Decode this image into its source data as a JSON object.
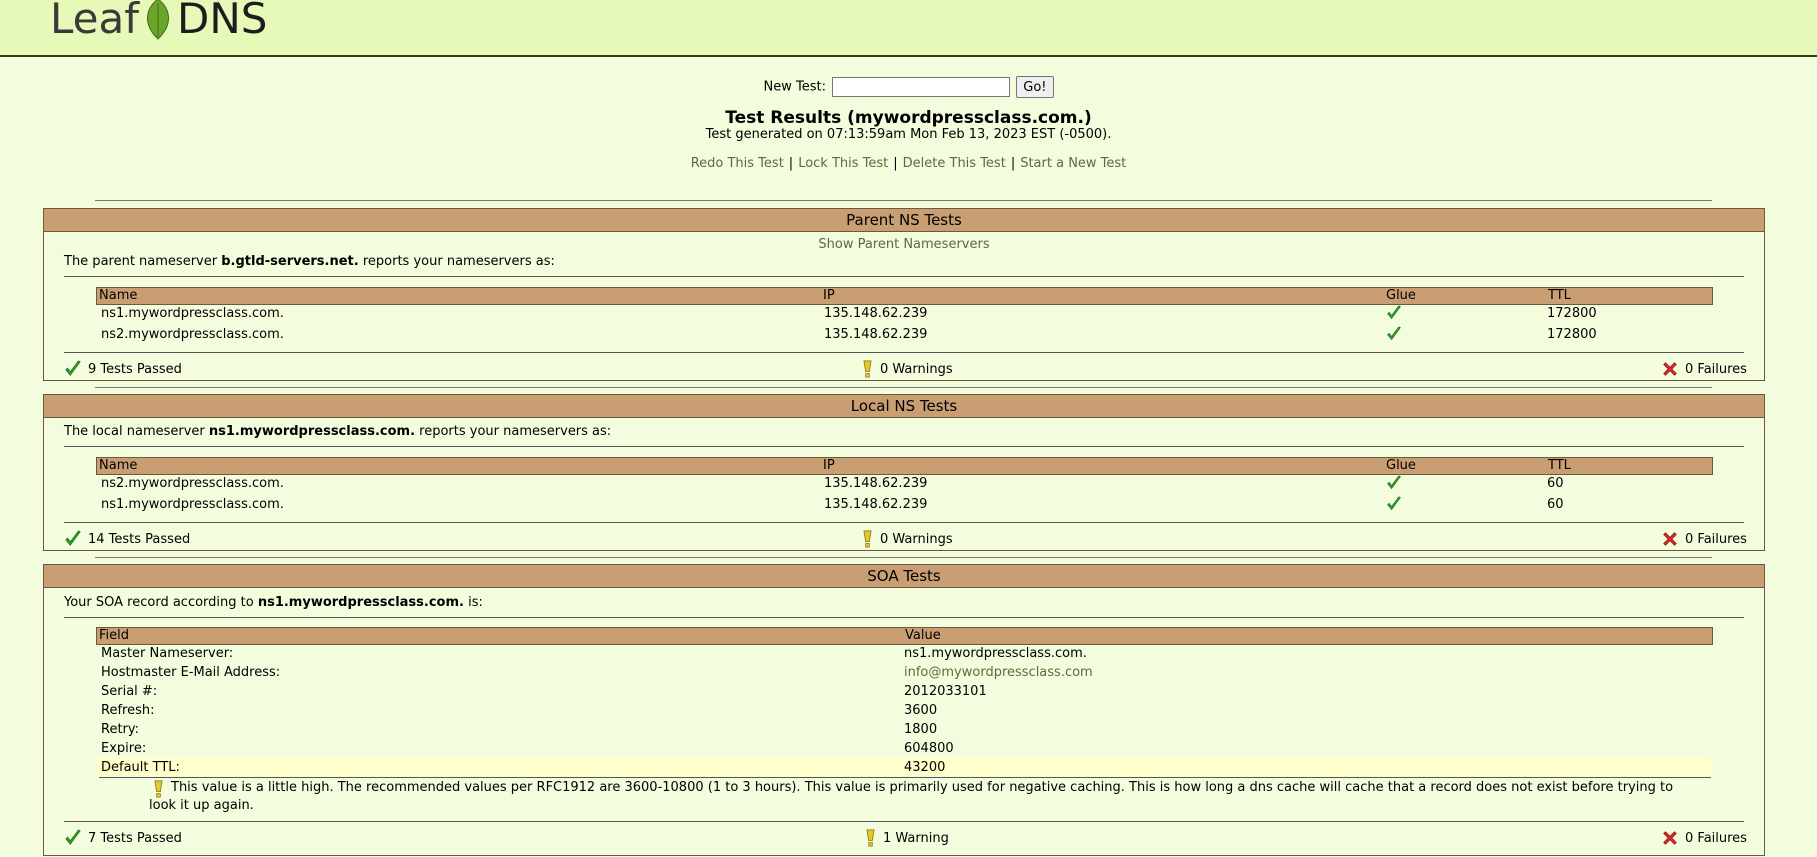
{
  "brand": {
    "left": "Leaf",
    "right": "DNS",
    "accent": "#6aa52a"
  },
  "new_test": {
    "label": "New Test:",
    "value": "",
    "button": "Go!"
  },
  "results_title": "Test Results (mywordpressclass.com.)",
  "generated": "Test generated on 07:13:59am Mon Feb 13, 2023 EST (-0500).",
  "actions": [
    "Redo This Test",
    "Lock This Test",
    "Delete This Test",
    "Start a New Test"
  ],
  "parent": {
    "title": "Parent NS Tests",
    "show_link": "Show Parent Nameservers",
    "intro_pre": "The parent nameserver ",
    "intro_bold": "b.gtld-servers.net.",
    "intro_post": " reports your nameservers as:",
    "columns": [
      "Name",
      "IP",
      "Glue",
      "TTL"
    ],
    "rows": [
      {
        "name": "ns1.mywordpressclass.com.",
        "ip": "135.148.62.239",
        "ttl": "172800"
      },
      {
        "name": "ns2.mywordpressclass.com.",
        "ip": "135.148.62.239",
        "ttl": "172800"
      }
    ],
    "passed": "9 Tests Passed",
    "warnings": "0 Warnings",
    "failures": "0 Failures"
  },
  "local": {
    "title": "Local NS Tests",
    "intro_pre": "The local nameserver ",
    "intro_bold": "ns1.mywordpressclass.com.",
    "intro_post": " reports your nameservers as:",
    "columns": [
      "Name",
      "IP",
      "Glue",
      "TTL"
    ],
    "rows": [
      {
        "name": "ns2.mywordpressclass.com.",
        "ip": "135.148.62.239",
        "ttl": "60"
      },
      {
        "name": "ns1.mywordpressclass.com.",
        "ip": "135.148.62.239",
        "ttl": "60"
      }
    ],
    "passed": "14 Tests Passed",
    "warnings": "0 Warnings",
    "failures": "0 Failures"
  },
  "soa": {
    "title": "SOA Tests",
    "intro_pre": "Your SOA record according to ",
    "intro_bold": "ns1.mywordpressclass.com.",
    "intro_post": " is:",
    "columns": [
      "Field",
      "Value"
    ],
    "rows": [
      {
        "field": "Master Nameserver:",
        "value": "ns1.mywordpressclass.com."
      },
      {
        "field": "Hostmaster E-Mail Address:",
        "value": "info@mywordpressclass.com"
      },
      {
        "field": "Serial #:",
        "value": "2012033101"
      },
      {
        "field": "Refresh:",
        "value": "3600"
      },
      {
        "field": "Retry:",
        "value": "1800"
      },
      {
        "field": "Expire:",
        "value": "604800"
      },
      {
        "field": "Default TTL:",
        "value": "43200"
      }
    ],
    "note": "This value is a little high. The recommended values per RFC1912 are 3600-10800 (1 to 3 hours). This value is primarily used for negative caching. This is how long a dns cache will cache that a record does not exist before trying to look it up again.",
    "passed": "7 Tests Passed",
    "warnings": "1 Warning",
    "failures": "0 Failures"
  },
  "icons": {
    "pass": "check-icon",
    "warning": "warning-icon",
    "failure": "x-icon",
    "glue": "check-icon"
  },
  "colors": {
    "header_bg": "#e6f9b9",
    "page_bg": "#f3fcdc",
    "section_head": "#c99e73",
    "link": "#5d6b3e"
  }
}
